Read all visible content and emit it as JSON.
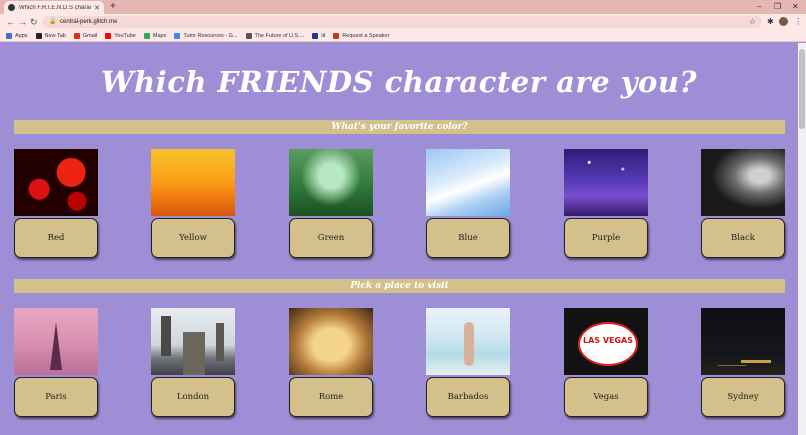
{
  "browser": {
    "tab_title": "Which F.R.I.E.N.D.S character are",
    "url": "central-perk.glitch.me",
    "bookmarks": [
      {
        "label": "Apps",
        "color": "#3b6fd6"
      },
      {
        "label": "New Tab",
        "color": "#222222"
      },
      {
        "label": "Gmail",
        "color": "#d93025"
      },
      {
        "label": "YouTube",
        "color": "#ff0000"
      },
      {
        "label": "Maps",
        "color": "#34a853"
      },
      {
        "label": "Tutor Resources - G...",
        "color": "#4285f4"
      },
      {
        "label": "The Future of U.S....",
        "color": "#555555"
      },
      {
        "label": "iit",
        "color": "#1f3a8a"
      },
      {
        "label": "Request a Speaker",
        "color": "#c0392b"
      }
    ]
  },
  "page": {
    "title": "Which FRIENDS character are you?",
    "questions": [
      {
        "prompt": "What's your favorite color?",
        "options": [
          {
            "label": "Red",
            "image": "red roses"
          },
          {
            "label": "Yellow",
            "image": "yellow sunset"
          },
          {
            "label": "Green",
            "image": "green garden"
          },
          {
            "label": "Blue",
            "image": "blue sky"
          },
          {
            "label": "Purple",
            "image": "purple night sky"
          },
          {
            "label": "Black",
            "image": "black silhouette"
          }
        ]
      },
      {
        "prompt": "Pick a place to visit",
        "options": [
          {
            "label": "Paris",
            "image": "eiffel tower"
          },
          {
            "label": "London",
            "image": "london bridge"
          },
          {
            "label": "Rome",
            "image": "trevi fountain"
          },
          {
            "label": "Barbados",
            "image": "beach"
          },
          {
            "label": "Vegas",
            "image": "las vegas sign"
          },
          {
            "label": "Sydney",
            "image": "sydney harbour at night"
          }
        ]
      }
    ]
  },
  "colors": {
    "page_background": "#9d8ed6",
    "accent_gold": "#d4c08a",
    "title_text": "#ffffff"
  }
}
